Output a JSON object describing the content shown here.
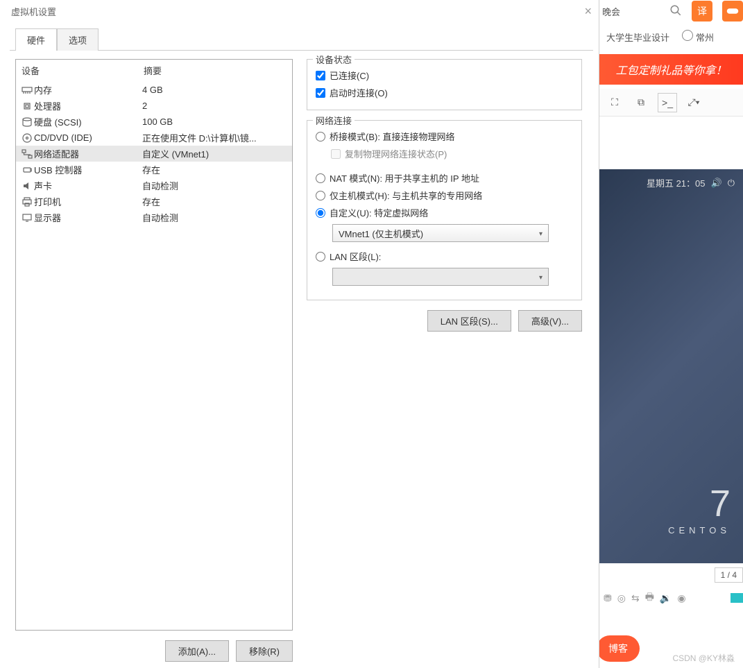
{
  "dialog": {
    "title": "虚拟机设置",
    "tabs": {
      "hardware": "硬件",
      "options": "选项"
    },
    "columns": {
      "device": "设备",
      "summary": "摘要"
    },
    "hardware": [
      {
        "icon": "memory-icon",
        "label": "内存",
        "summary": "4 GB"
      },
      {
        "icon": "cpu-icon",
        "label": "处理器",
        "summary": "2"
      },
      {
        "icon": "disk-icon",
        "label": "硬盘 (SCSI)",
        "summary": "100 GB"
      },
      {
        "icon": "cd-icon",
        "label": "CD/DVD (IDE)",
        "summary": "正在使用文件 D:\\计算机\\镜..."
      },
      {
        "icon": "network-icon",
        "label": "网络适配器",
        "summary": "自定义 (VMnet1)"
      },
      {
        "icon": "usb-icon",
        "label": "USB 控制器",
        "summary": "存在"
      },
      {
        "icon": "sound-icon",
        "label": "声卡",
        "summary": "自动检测"
      },
      {
        "icon": "printer-icon",
        "label": "打印机",
        "summary": "存在"
      },
      {
        "icon": "display-icon",
        "label": "显示器",
        "summary": "自动检测"
      }
    ],
    "selected_index": 4,
    "buttons": {
      "add": "添加(A)...",
      "remove": "移除(R)"
    },
    "right": {
      "device_status": {
        "legend": "设备状态",
        "connected": "已连接(C)",
        "connect_at_power": "启动时连接(O)"
      },
      "network": {
        "legend": "网络连接",
        "bridged": "桥接模式(B): 直接连接物理网络",
        "replicate": "复制物理网络连接状态(P)",
        "nat": "NAT 模式(N): 用于共享主机的 IP 地址",
        "hostonly": "仅主机模式(H): 与主机共享的专用网络",
        "custom": "自定义(U): 特定虚拟网络",
        "custom_value": "VMnet1 (仅主机模式)",
        "lan": "LAN 区段(L):",
        "lan_value": ""
      },
      "buttons": {
        "lan_segments": "LAN 区段(S)...",
        "advanced": "高级(V)..."
      }
    }
  },
  "background": {
    "top_tab": "晚会",
    "translate_btn": "译",
    "bookmark1": "大学生毕业设计",
    "bookmark2": "常州",
    "banner": "工包定制礼品等你拿！",
    "vm_clock": "星期五 21：05",
    "centos_num": "7",
    "centos_label": "CENTOS",
    "pager": "1 / 4",
    "bottom_btn": "博客",
    "watermark": "CSDN @KY林淼"
  }
}
